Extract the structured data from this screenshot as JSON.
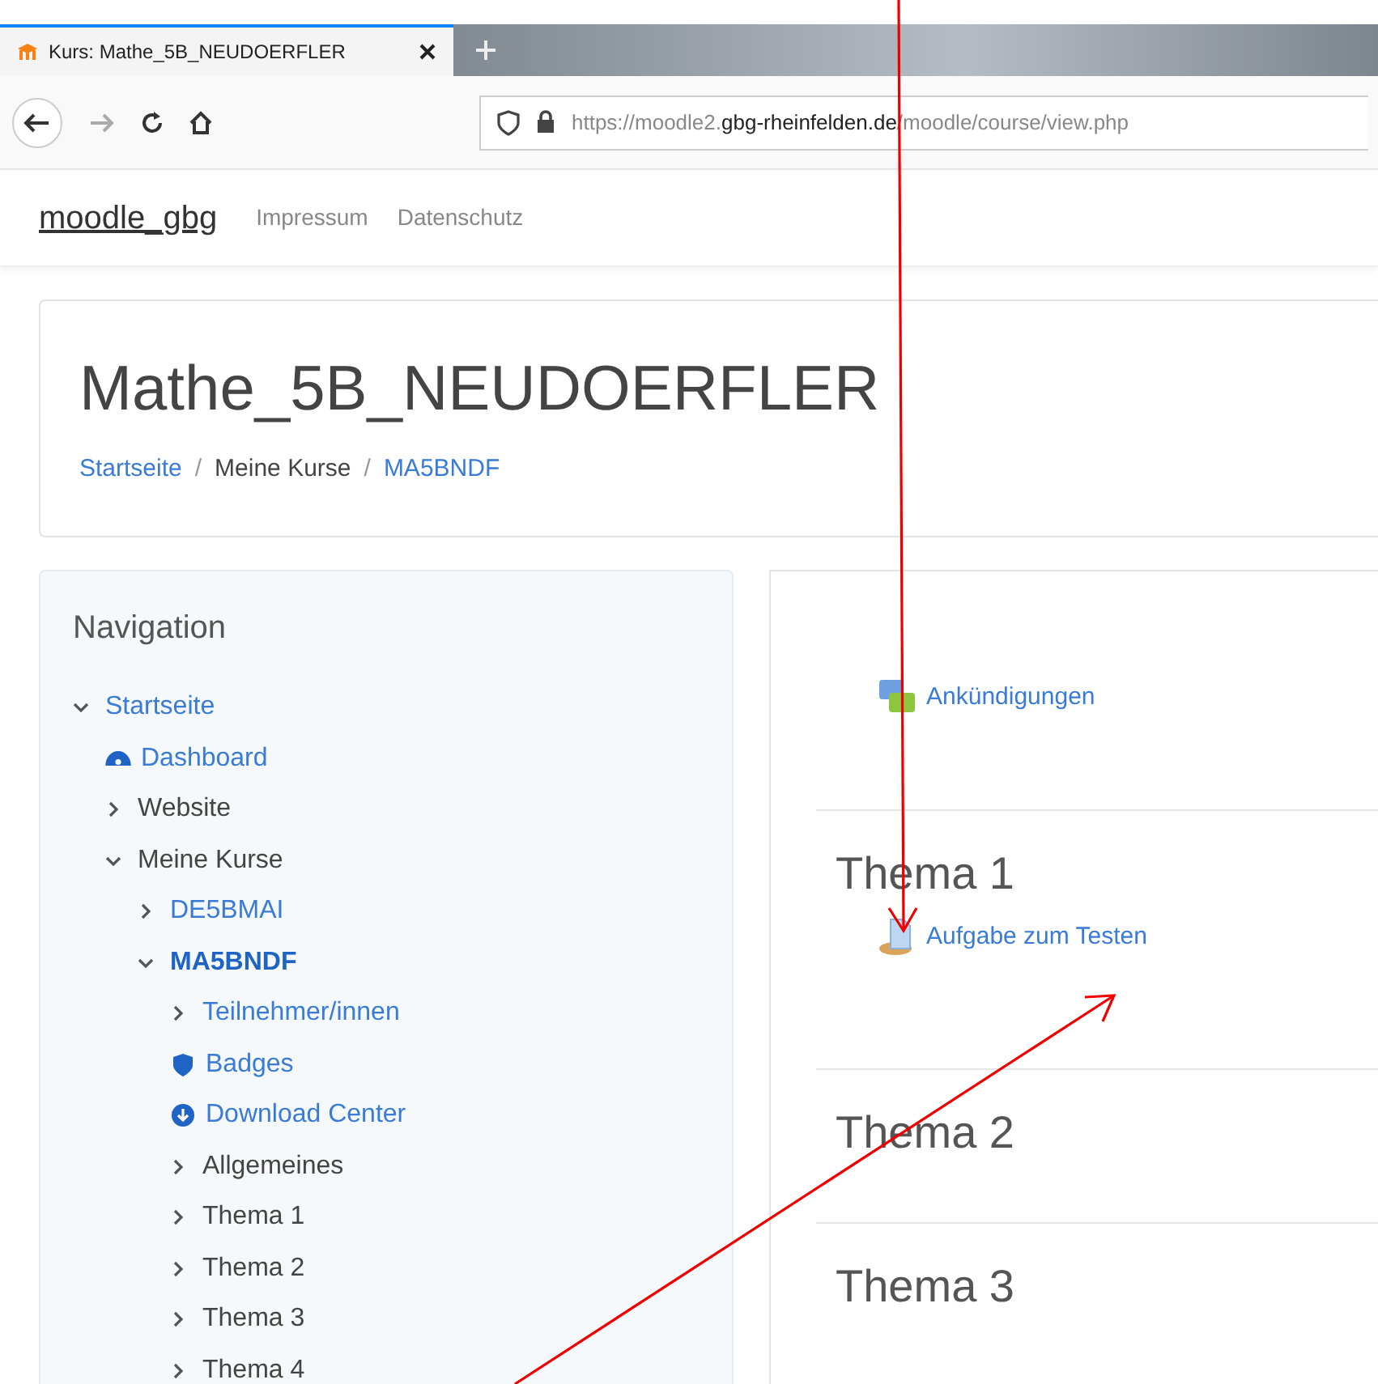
{
  "browser": {
    "tab": {
      "title": "Kurs: Mathe_5B_NEUDOERFLER",
      "selected": true
    },
    "url": "https://moodle2.**gbg-rheinfelden.de**/moodle/course/view.php"
  },
  "navbar": {
    "brand": "moodle_gbg",
    "links": [
      "Impressum",
      "Datenschutz"
    ]
  },
  "header": {
    "title": "Mathe_5B_NEUDOERFLER",
    "separator": "/",
    "breadcrumb": [
      {
        "label": "Startseite",
        "link": true
      },
      {
        "label": "Meine Kurse",
        "link": false
      },
      {
        "label": "MA5BNDF",
        "link": true
      }
    ]
  },
  "navigation": {
    "title": "Navigation",
    "tree": [
      {
        "label": "Startseite",
        "kind": "toggle",
        "link": true,
        "selected": false,
        "expanded": true,
        "children": [
          {
            "label": "Dashboard",
            "kind": "dashboard",
            "link": true,
            "selected": false
          },
          {
            "label": "Website",
            "kind": "toggle",
            "link": false,
            "selected": false,
            "expanded": false
          },
          {
            "label": "Meine Kurse",
            "kind": "toggle",
            "link": false,
            "selected": false,
            "expanded": true,
            "children": [
              {
                "label": "DE5BMAI",
                "kind": "toggle",
                "link": true,
                "selected": false,
                "expanded": false
              },
              {
                "label": "MA5BNDF",
                "kind": "toggle",
                "link": true,
                "selected": true,
                "expanded": true,
                "children": [
                  {
                    "label": "Teilnehmer/innen",
                    "kind": "toggle",
                    "link": true,
                    "selected": false,
                    "expanded": false
                  },
                  {
                    "label": "Badges",
                    "kind": "badge",
                    "link": true,
                    "selected": false
                  },
                  {
                    "label": "Download Center",
                    "kind": "download",
                    "link": true,
                    "selected": false
                  },
                  {
                    "label": "Allgemeines",
                    "kind": "toggle",
                    "link": false,
                    "selected": false,
                    "expanded": false
                  },
                  {
                    "label": "Thema 1",
                    "kind": "toggle",
                    "link": false,
                    "selected": false,
                    "expanded": false
                  },
                  {
                    "label": "Thema 2",
                    "kind": "toggle",
                    "link": false,
                    "selected": false,
                    "expanded": false
                  },
                  {
                    "label": "Thema 3",
                    "kind": "toggle",
                    "link": false,
                    "selected": false,
                    "expanded": false
                  },
                  {
                    "label": "Thema 4",
                    "kind": "toggle",
                    "link": false,
                    "selected": false,
                    "expanded": false
                  }
                ]
              }
            ]
          }
        ]
      }
    ]
  },
  "course": {
    "intro": [
      {
        "kind": "forum",
        "label": "Ankündigungen"
      }
    ],
    "sections": [
      {
        "title": "Thema 1",
        "activities": [
          {
            "kind": "assign",
            "label": "Aufgabe zum Testen"
          }
        ]
      },
      {
        "title": "Thema 2"
      },
      {
        "title": "Thema 3"
      }
    ]
  }
}
